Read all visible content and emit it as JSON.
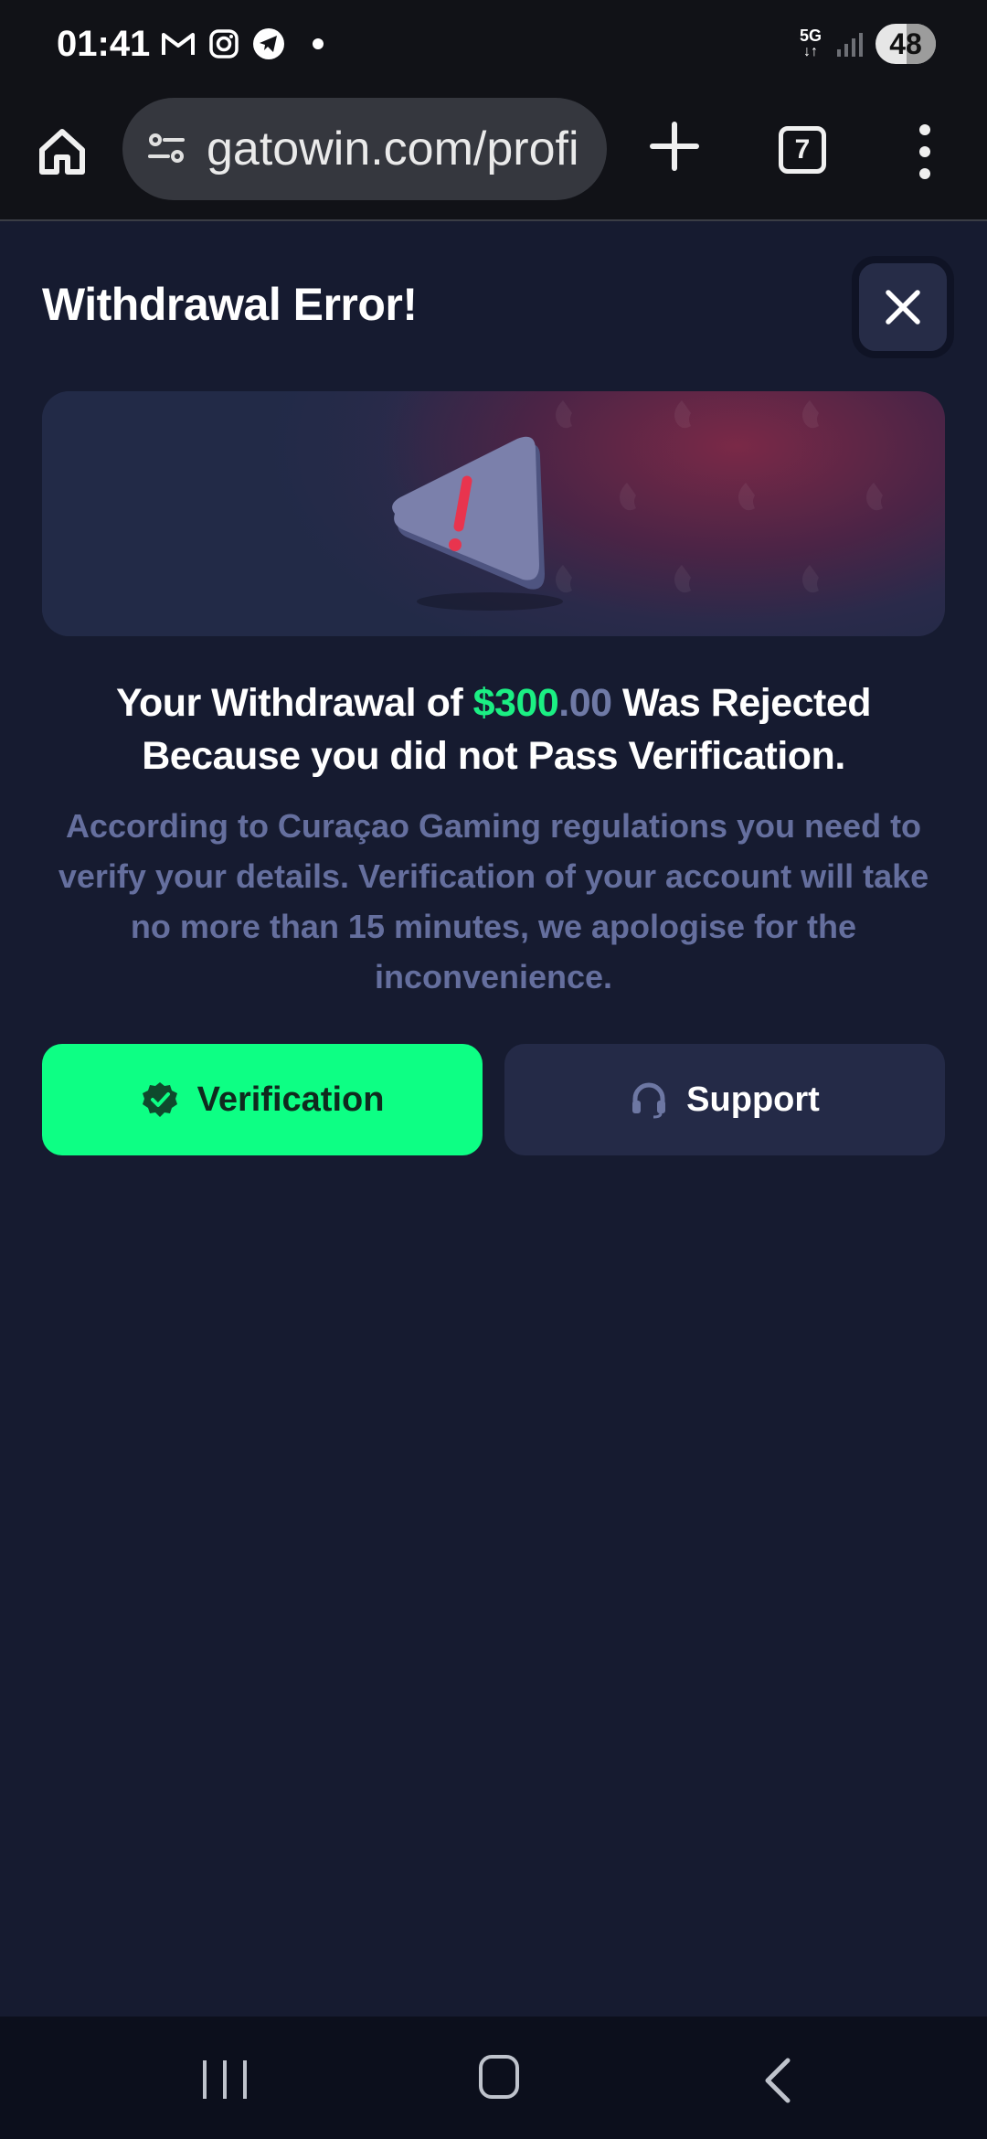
{
  "status_bar": {
    "time": "01:41",
    "network": "5G",
    "battery": "48",
    "icons": [
      "gmail-icon",
      "instagram-icon",
      "telegram-icon",
      "notification-dot-icon",
      "signal-icon"
    ]
  },
  "browser": {
    "url": "gatowin.com/profi",
    "tab_count": "7",
    "icons": [
      "home-icon",
      "site-settings-icon",
      "new-tab-icon",
      "tabs-icon",
      "more-menu-icon"
    ]
  },
  "modal": {
    "title": "Withdrawal Error!",
    "headline_prefix": "Your Withdrawal of ",
    "amount_main": "$300",
    "amount_cents": ".00",
    "headline_suffix": " Was Rejected",
    "headline_line2": "Because you did not Pass Verification.",
    "body": "According to Curaçao Gaming regulations you need to verify your details. Verification of your account will take no more than 15 minutes, we apologise for the inconvenience.",
    "verify_label": "Verification",
    "support_label": "Support"
  },
  "colors": {
    "accent_green": "#0dff84",
    "amount_green": "#1bef83",
    "background": "#161b30",
    "secondary_button": "#242a47",
    "muted_text": "#656f9e"
  }
}
